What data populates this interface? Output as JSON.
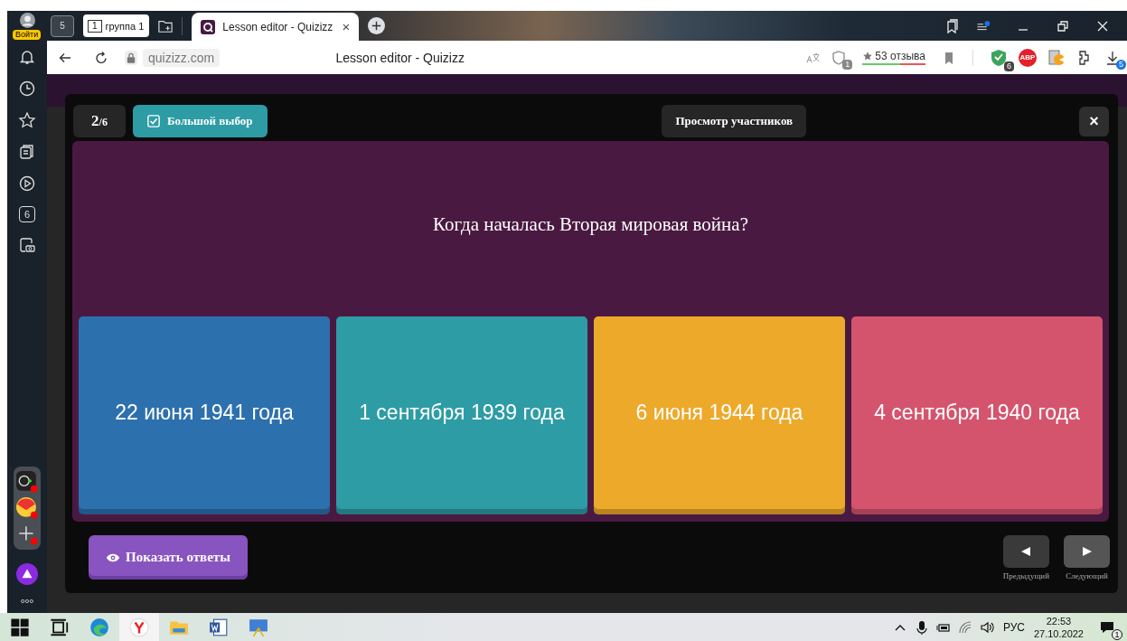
{
  "browser": {
    "profile_badge": "Войти",
    "home_count": "5",
    "tab_group": {
      "number": "1",
      "label": "группа 1"
    },
    "tabs": [
      {
        "title": "Lesson editor - Quizizz",
        "selected": true,
        "close": "×"
      }
    ],
    "address": "quizizz.com",
    "page_title": "Lesson editor - Quizizz",
    "shield_count": "1",
    "reviews": "53 отзыва",
    "extension_count": "6",
    "adblock": "ABP",
    "downloads_count": "5",
    "sidebar_counter": "6"
  },
  "modal": {
    "counter": {
      "current": "2",
      "total": "/6"
    },
    "question_type": "Большой выбор",
    "participant_view": "Просмотр участников",
    "close": "×",
    "question": "Когда началась Вторая мировая война?",
    "options": [
      {
        "text": "22 июня 1941 года",
        "color": "#2d70ae"
      },
      {
        "text": "1 сентября 1939 года",
        "color": "#2d9ca5"
      },
      {
        "text": "6 июня 1944 года",
        "color": "#eda92a"
      },
      {
        "text": "4 сентября 1940 года",
        "color": "#d5546d"
      }
    ],
    "show_answers": "Показать ответы",
    "previous": "Предыдущий",
    "next": "Следующий"
  },
  "taskbar": {
    "language": "РУС",
    "time": "22:53",
    "date": "27.10.2022",
    "notifications": "1"
  }
}
